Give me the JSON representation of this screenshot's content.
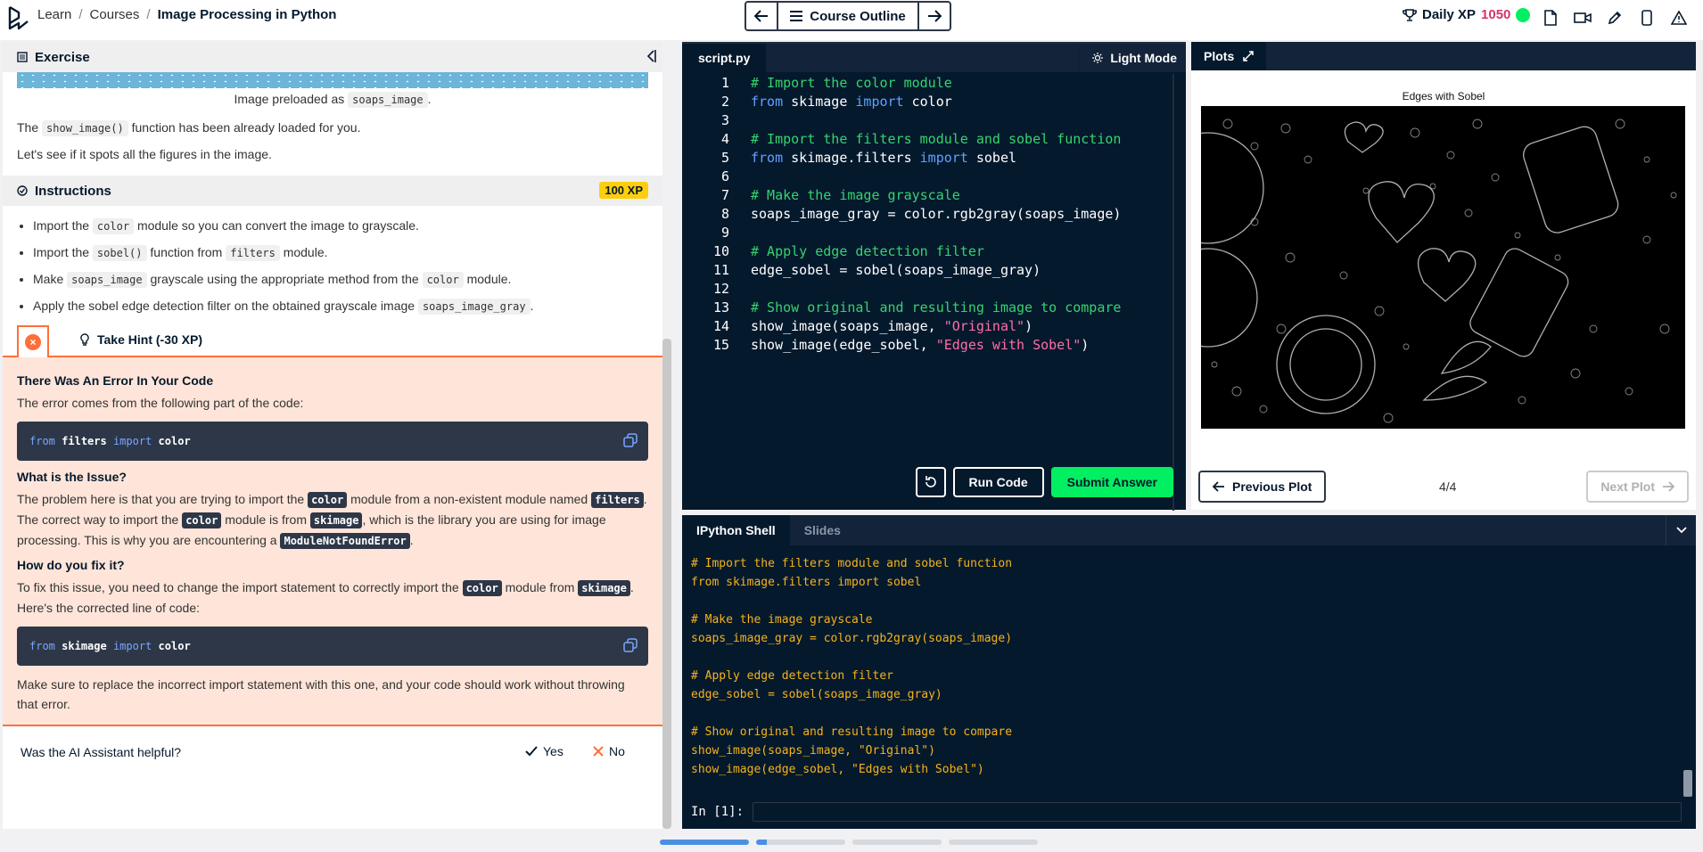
{
  "header": {
    "breadcrumb": [
      "Learn",
      "Courses",
      "Image Processing in Python"
    ],
    "course_outline_label": "Course Outline",
    "daily_xp_label": "Daily XP",
    "daily_xp_value": "1050"
  },
  "exercise": {
    "section_title": "Exercise",
    "caption_prefix": "Image preloaded as",
    "caption_code": "soaps_image",
    "caption_suffix": ".",
    "p1_prefix": "The",
    "p1_code": "show_image()",
    "p1_suffix": "function has been already loaded for you.",
    "p2": "Let's see if it spots all the figures in the image."
  },
  "instructions": {
    "section_title": "Instructions",
    "xp_badge": "100 XP",
    "items": [
      {
        "a": "Import the",
        "code": "color",
        "b": "module so you can convert the image to grayscale.",
        "code2": "",
        "c": ""
      },
      {
        "a": "Import the",
        "code": "sobel()",
        "b": "function from",
        "code2": "filters",
        "c": "module."
      },
      {
        "a": "Make",
        "code": "soaps_image",
        "b": "grayscale using the appropriate method from the",
        "code2": "color",
        "c": "module."
      },
      {
        "a": "Apply the sobel edge detection filter on the obtained grayscale image",
        "code": "soaps_image_gray",
        "b": ".",
        "code2": "",
        "c": ""
      }
    ],
    "hint_label": "Take Hint (-30 XP)"
  },
  "error_panel": {
    "title": "There Was An Error In Your Code",
    "intro": "The error comes from the following part of the code:",
    "code1": {
      "kw1": "from",
      "mod": "filters",
      "kw2": "import",
      "name": "color"
    },
    "issue_title": "What is the Issue?",
    "issue_text": [
      "The problem here is that you are trying to import the",
      "color",
      "module from a non-existent module named",
      "filters",
      ". The correct way to import the",
      "color",
      "module is from",
      "skimage",
      ", which is the library you are using for image processing. This is why you are encountering a",
      "ModuleNotFoundError",
      "."
    ],
    "fix_title": "How do you fix it?",
    "fix_text": [
      "To fix this issue, you need to change the import statement to correctly import the",
      "color",
      "module from",
      "skimage",
      ". Here's the corrected line of code:"
    ],
    "code2": {
      "kw1": "from",
      "mod": "skimage",
      "kw2": "import",
      "name": "color"
    },
    "closing": "Make sure to replace the incorrect import statement with this one, and your code should work without throwing that error."
  },
  "feedback": {
    "question": "Was the AI Assistant helpful?",
    "yes": "Yes",
    "no": "No"
  },
  "editor": {
    "tab": "script.py",
    "light_mode": "Light Mode",
    "lines": [
      {
        "n": "1",
        "parts": [
          [
            "c",
            "# Import the color module"
          ]
        ]
      },
      {
        "n": "2",
        "parts": [
          [
            "k",
            "from"
          ],
          [
            "t",
            " skimage "
          ],
          [
            "k",
            "import"
          ],
          [
            "t",
            " color"
          ]
        ]
      },
      {
        "n": "3",
        "parts": []
      },
      {
        "n": "4",
        "parts": [
          [
            "c",
            "# Import the filters module and sobel function"
          ]
        ]
      },
      {
        "n": "5",
        "parts": [
          [
            "k",
            "from"
          ],
          [
            "t",
            " skimage.filters "
          ],
          [
            "k",
            "import"
          ],
          [
            "t",
            " sobel"
          ]
        ]
      },
      {
        "n": "6",
        "parts": []
      },
      {
        "n": "7",
        "parts": [
          [
            "c",
            "# Make the image grayscale"
          ]
        ]
      },
      {
        "n": "8",
        "parts": [
          [
            "t",
            "soaps_image_gray = color.rgb2gray(soaps_image)"
          ]
        ]
      },
      {
        "n": "9",
        "parts": []
      },
      {
        "n": "10",
        "parts": [
          [
            "c",
            "# Apply edge detection filter"
          ]
        ]
      },
      {
        "n": "11",
        "parts": [
          [
            "t",
            "edge_sobel = sobel(soaps_image_gray)"
          ]
        ]
      },
      {
        "n": "12",
        "parts": []
      },
      {
        "n": "13",
        "parts": [
          [
            "c",
            "# Show original and resulting image to compare"
          ]
        ]
      },
      {
        "n": "14",
        "parts": [
          [
            "t",
            "show_image(soaps_image, "
          ],
          [
            "s",
            "\"Original\""
          ],
          [
            "t",
            ")"
          ]
        ]
      },
      {
        "n": "15",
        "parts": [
          [
            "t",
            "show_image(edge_sobel, "
          ],
          [
            "s",
            "\"Edges with Sobel\""
          ],
          [
            "t",
            ")"
          ]
        ]
      }
    ],
    "run_label": "Run Code",
    "submit_label": "Submit Answer"
  },
  "plots": {
    "tab": "Plots",
    "plot_title": "Edges with Sobel",
    "prev_label": "Previous Plot",
    "next_label": "Next Plot",
    "counter": "4/4"
  },
  "shell": {
    "tab_active": "IPython Shell",
    "tab_inactive": "Slides",
    "lines": [
      "# Import the filters module and sobel function",
      "from skimage.filters import sobel",
      "",
      "# Make the image grayscale",
      "soaps_image_gray = color.rgb2gray(soaps_image)",
      "",
      "# Apply edge detection filter",
      "edge_sobel = sobel(soaps_image_gray)",
      "",
      "# Show original and resulting image to compare",
      "show_image(soaps_image, \"Original\")",
      "show_image(edge_sobel, \"Edges with Sobel\")"
    ],
    "prompt": "In [1]:"
  },
  "colors": {
    "accent_green": "#03ef62",
    "navy": "#05192d",
    "error_orange": "#ff6f3a",
    "xp_pink": "#d6336c"
  }
}
